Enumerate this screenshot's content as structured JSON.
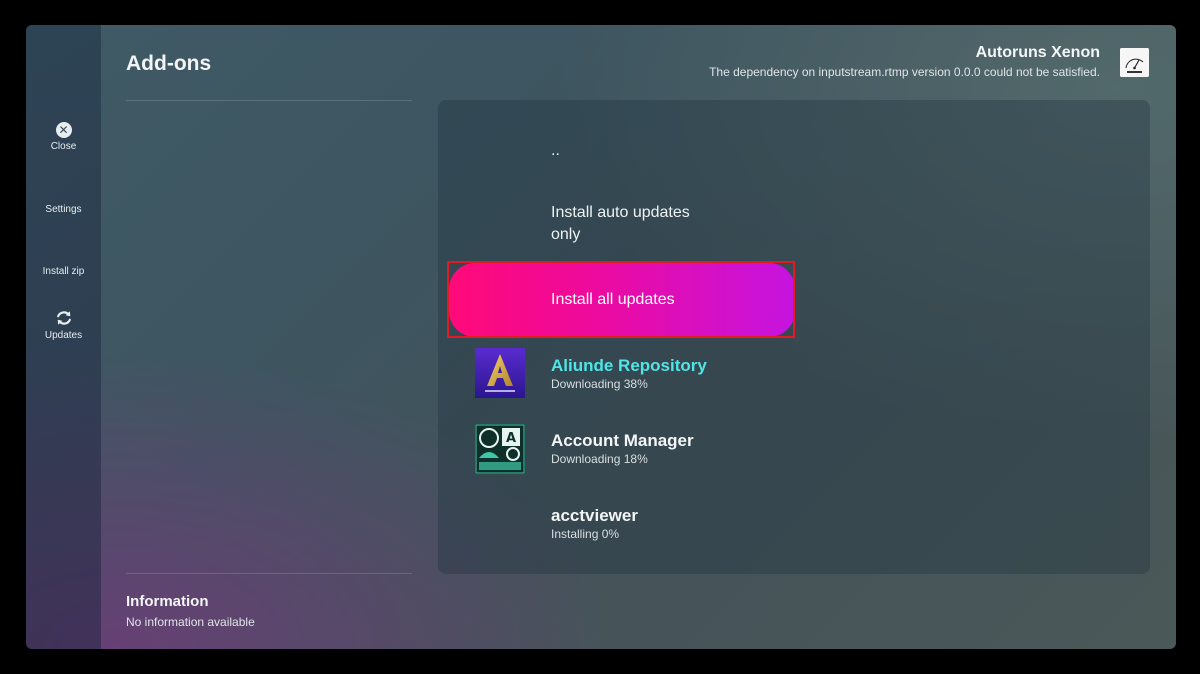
{
  "header": {
    "title": "Add-ons"
  },
  "addon_info": {
    "name": "Autoruns Xenon",
    "message": "The dependency on inputstream.rtmp version 0.0.0 could not be satisfied."
  },
  "sidebar": {
    "items": [
      {
        "label": "Close",
        "icon": "close-icon"
      },
      {
        "label": "Settings"
      },
      {
        "label": "Install zip"
      },
      {
        "label": "Updates",
        "icon": "refresh-icon"
      }
    ]
  },
  "list": {
    "parent": "..",
    "install_auto_line1": "Install auto updates",
    "install_auto_line2": "only",
    "install_all": "Install all updates",
    "items": [
      {
        "title": "Aliunde Repository",
        "status": "Downloading 38%",
        "title_color": "#4ee6e6",
        "icon": "aliunde-logo"
      },
      {
        "title": "Account Manager",
        "status": "Downloading 18%",
        "title_color": "#f3f5f6",
        "icon": "account-manager-logo"
      },
      {
        "title": "acctviewer",
        "status": "Installing 0%",
        "title_color": "#f3f5f6"
      }
    ]
  },
  "info": {
    "title": "Information",
    "text": "No information available"
  },
  "colors": {
    "highlight_start": "#ff0a78",
    "highlight_end": "#c514e0",
    "selection_outline": "#e01b24"
  }
}
